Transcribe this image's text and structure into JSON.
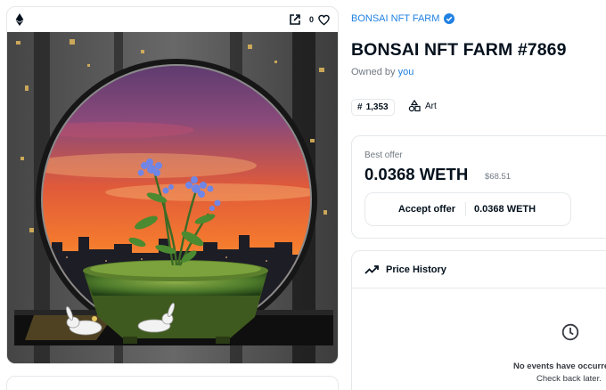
{
  "media": {
    "favorite_count": "0",
    "icons": {
      "chain": "ethereum-icon",
      "external": "external-link-icon",
      "favorite": "heart-icon"
    }
  },
  "item": {
    "collection": "BONSAI NFT FARM",
    "title": "BONSAI NFT FARM #7869",
    "owned_by_prefix": "Owned by",
    "owner": "you",
    "rank_hash": "#",
    "rank": "1,353",
    "category": "Art"
  },
  "offer": {
    "label": "Best offer",
    "price": "0.0368 WETH",
    "usd": "$68.51",
    "accept_label": "Accept offer",
    "accept_price": "0.0368 WETH"
  },
  "price_history": {
    "title": "Price History",
    "empty_title": "No events have occurre",
    "empty_sub": "Check back later."
  },
  "colors": {
    "accent": "#2081e2",
    "text": "#04111d",
    "muted": "#707a83",
    "border": "#e5e8eb"
  }
}
